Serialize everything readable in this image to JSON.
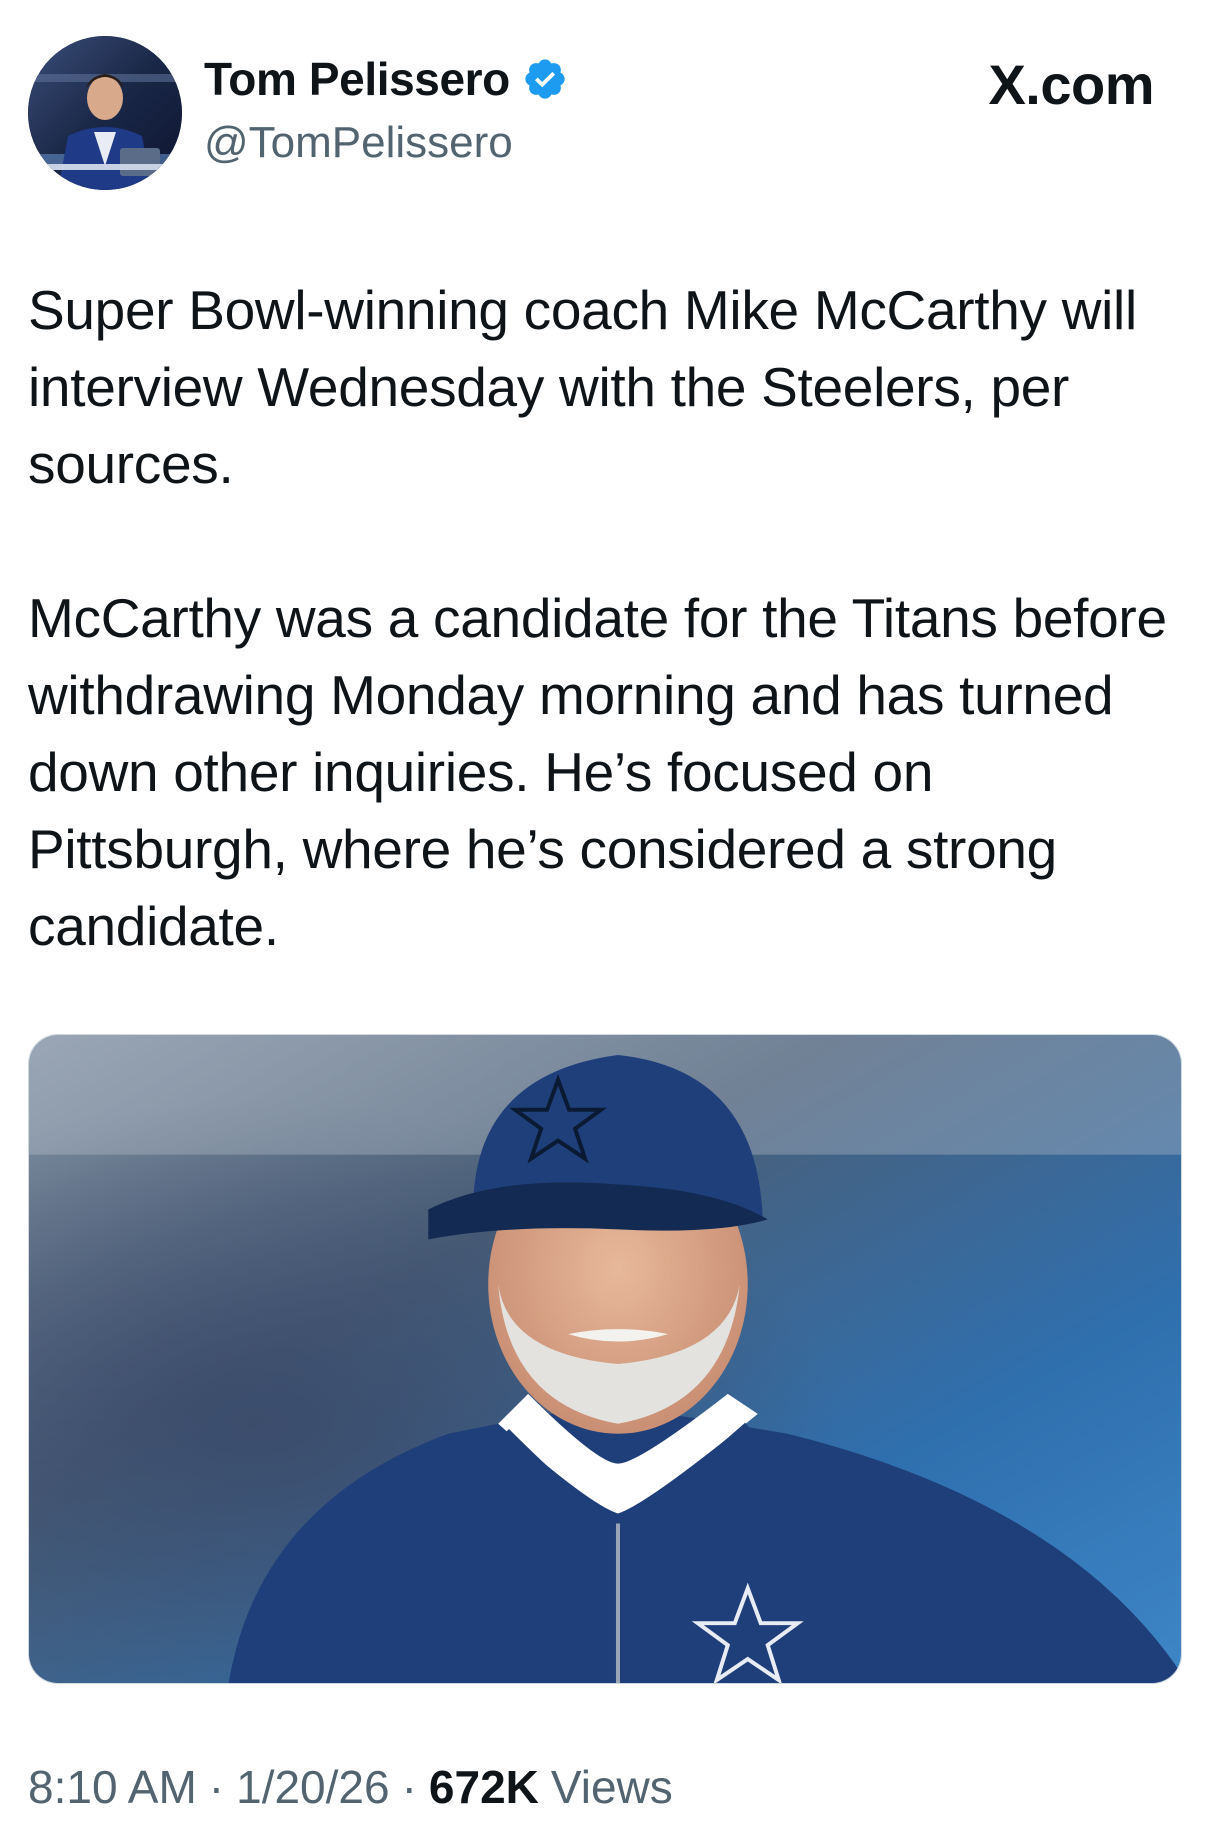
{
  "author": {
    "display_name": "Tom Pelissero",
    "handle": "@TomPelissero",
    "verified": true,
    "verified_color": "#1d9bf0",
    "avatar_icon": "avatar-photo"
  },
  "source": {
    "label": "X.com",
    "icon": "x-logo-icon"
  },
  "tweet": {
    "paragraphs": [
      "Super Bowl-winning coach Mike McCarthy will interview Wednesday with the Steelers, per sources.",
      "McCarthy was a candidate for the Titans before withdrawing Monday morning and has turned down other inquiries. He’s focused on Pittsburgh, where he’s considered a strong candidate."
    ]
  },
  "media": {
    "type": "photo",
    "accent_colors": [
      "#1f3f7a",
      "#2b5fa8",
      "#6f8fb2"
    ]
  },
  "meta": {
    "time": "8:10 AM",
    "date": "1/20/26",
    "views_count": "672K",
    "views_label": "Views",
    "separator": "·"
  },
  "colors": {
    "text_primary": "#0f1419",
    "text_secondary": "#536471",
    "background": "#ffffff"
  }
}
